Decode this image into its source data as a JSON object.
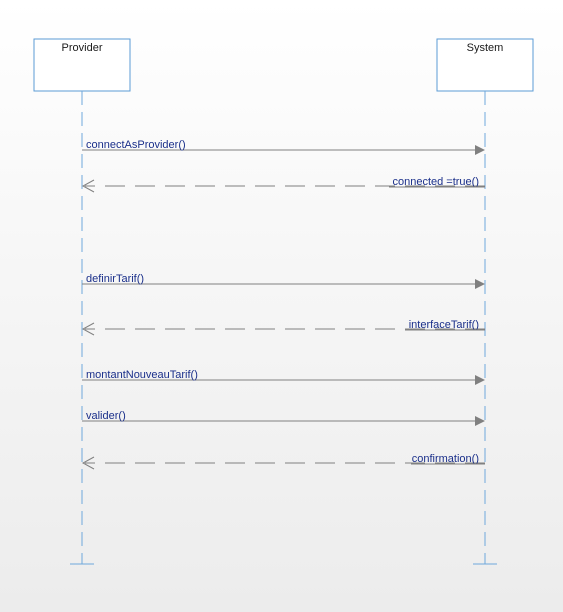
{
  "lifelines": [
    {
      "id": "provider",
      "name": "Provider"
    },
    {
      "id": "system",
      "name": "System"
    }
  ],
  "messages": [
    {
      "label": "connectAsProvider()",
      "from": "provider",
      "to": "system",
      "kind": "call"
    },
    {
      "label": "connected =true()",
      "from": "system",
      "to": "provider",
      "kind": "return"
    },
    {
      "label": "definirTarif()",
      "from": "provider",
      "to": "system",
      "kind": "call"
    },
    {
      "label": "interfaceTarif()",
      "from": "system",
      "to": "provider",
      "kind": "return"
    },
    {
      "label": "montantNouveauTarif()",
      "from": "provider",
      "to": "system",
      "kind": "call"
    },
    {
      "label": "valider()",
      "from": "provider",
      "to": "system",
      "kind": "call"
    },
    {
      "label": "confirmation()",
      "from": "system",
      "to": "provider",
      "kind": "return"
    }
  ],
  "colors": {
    "box_stroke": "#5b9bd5",
    "lifeline": "#6fa8dc",
    "arrow": "#808080",
    "label": "#1a2f8a"
  }
}
